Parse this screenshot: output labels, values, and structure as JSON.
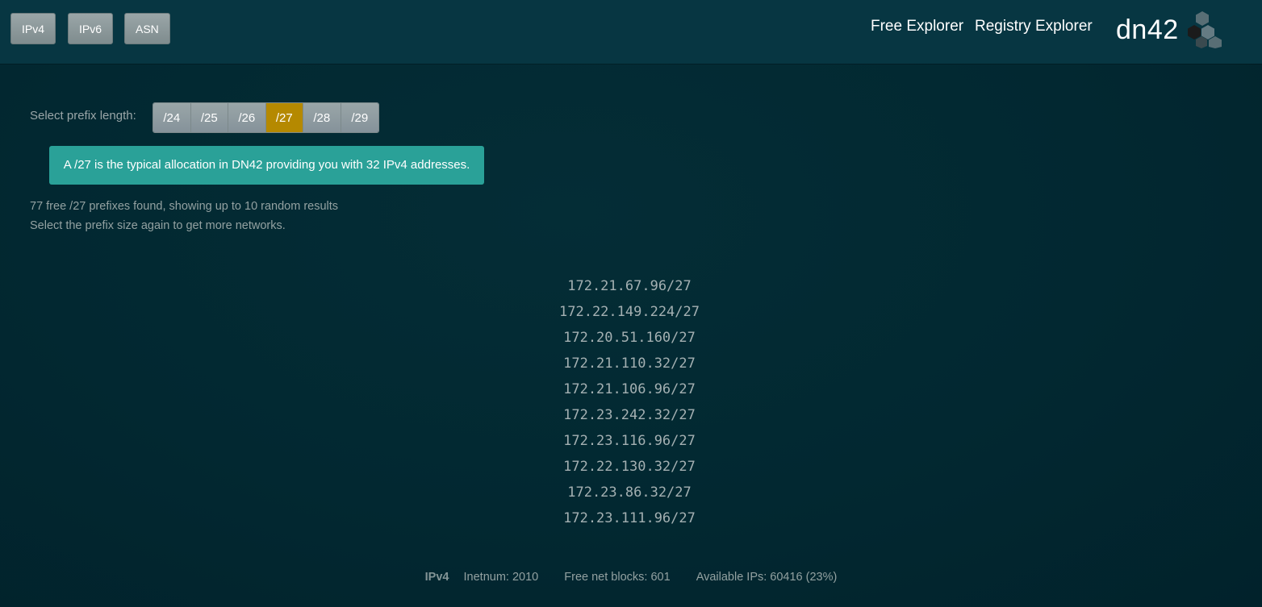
{
  "navbar": {
    "buttons": [
      "IPv4",
      "IPv6",
      "ASN"
    ],
    "links": [
      "Free Explorer",
      "Registry Explorer"
    ],
    "logo_text": "dn42"
  },
  "prefix_selector": {
    "label": "Select prefix length:",
    "options": [
      "/24",
      "/25",
      "/26",
      "/27",
      "/28",
      "/29"
    ],
    "selected": "/27"
  },
  "info": {
    "message": "A /27 is the typical allocation in DN42 providing you with 32 IPv4 addresses."
  },
  "results": {
    "summary": "77 free /27 prefixes found, showing up to 10 random results",
    "hint": "Select the prefix size again to get more networks.",
    "prefixes": [
      "172.21.67.96/27",
      "172.22.149.224/27",
      "172.20.51.160/27",
      "172.21.110.32/27",
      "172.21.106.96/27",
      "172.23.242.32/27",
      "172.23.116.96/27",
      "172.22.130.32/27",
      "172.23.86.32/27",
      "172.23.111.96/27"
    ]
  },
  "footer": {
    "label": "IPv4",
    "inetnum": "Inetnum: 2010",
    "free_blocks": "Free net blocks: 601",
    "available": "Available IPs: 60416 (23%)"
  },
  "colors": {
    "navbar": "#073642",
    "background": "#022b36",
    "active_prefix": "#b58900",
    "info_box": "#2aa198"
  }
}
